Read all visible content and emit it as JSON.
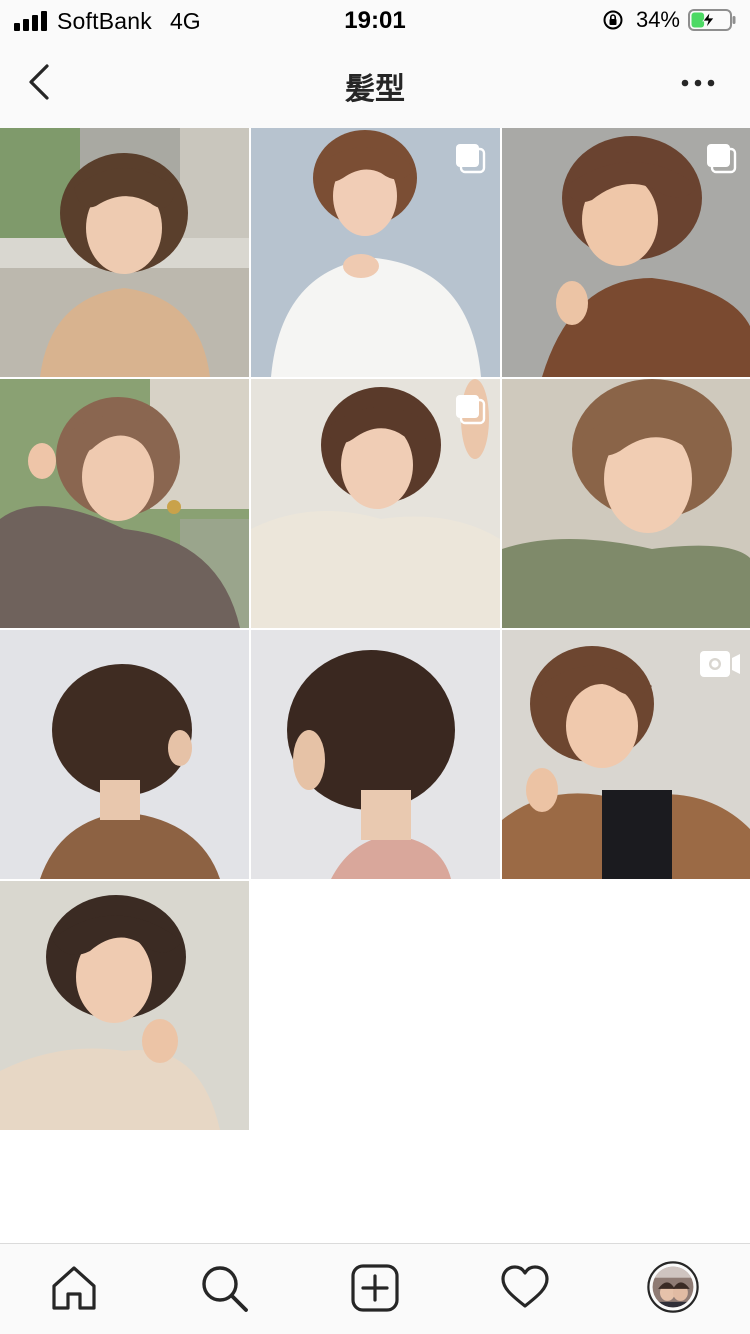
{
  "status_bar": {
    "carrier": "SoftBank",
    "network": "4G",
    "time": "19:01",
    "battery_percent": "34%",
    "battery_level": 0.34
  },
  "header": {
    "title": "髪型",
    "back_icon": "chevron-left-icon",
    "more_icon": "ellipsis-icon"
  },
  "grid": {
    "posts": [
      {
        "type": "photo"
      },
      {
        "type": "carousel"
      },
      {
        "type": "carousel"
      },
      {
        "type": "photo"
      },
      {
        "type": "carousel"
      },
      {
        "type": "photo"
      },
      {
        "type": "photo"
      },
      {
        "type": "photo"
      },
      {
        "type": "video"
      },
      {
        "type": "photo"
      }
    ]
  },
  "tab_bar": {
    "items": [
      "home-icon",
      "search-icon",
      "new-post-icon",
      "activity-heart-icon",
      "profile-avatar"
    ]
  },
  "colors": {
    "bar_background": "#fafafa",
    "text": "#262626",
    "divider": "#dbdbdb"
  }
}
